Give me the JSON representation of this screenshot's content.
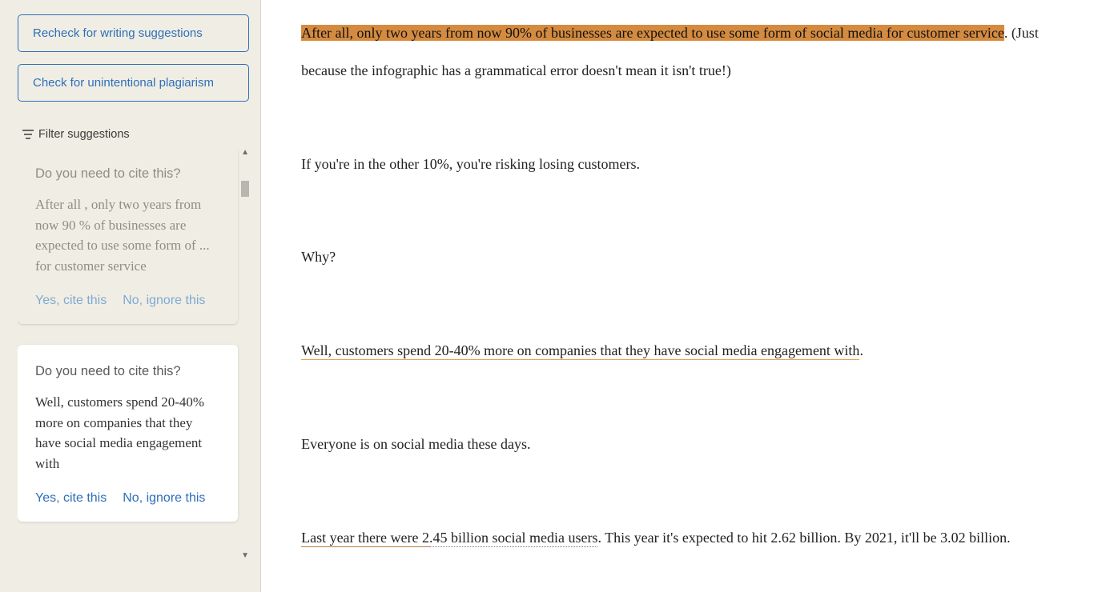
{
  "sidebar": {
    "recheck_label": "Recheck for writing suggestions",
    "plagiarism_label": "Check for unintentional plagiarism",
    "filter_label": "Filter suggestions",
    "cards": [
      {
        "title": "Do you need to cite this?",
        "body": "After all , only two years from now 90 % of businesses are expected to use some form of ... for customer service",
        "yes": "Yes, cite this",
        "no": "No, ignore this"
      },
      {
        "title": "Do you need to cite this?",
        "body": "Well, customers spend 20-40% more on companies that they have social media engagement with",
        "yes": "Yes, cite this",
        "no": "No, ignore this"
      }
    ]
  },
  "doc": {
    "p1_hl": "After all, only two years from now 90% of businesses are expected to use some form of social media for customer service",
    "p1_rest": ". (Just because the infographic has a grammatical error doesn't mean it isn't true!)",
    "p2": "If you're in the other 10%, you're risking losing customers.",
    "p3": "Why?",
    "p4_u": "Well, customers spend 20-40% more on companies that they have social media engagement with",
    "p4_rest": ".",
    "p5": "Everyone is on social media these days.",
    "p6_u1": "Last year there were 2",
    "p6_u2": ".45 billion social media users",
    "p6_rest": ". This year it's expected to hit 2.62 billion. By 2021, it'll be 3.02 billion."
  }
}
